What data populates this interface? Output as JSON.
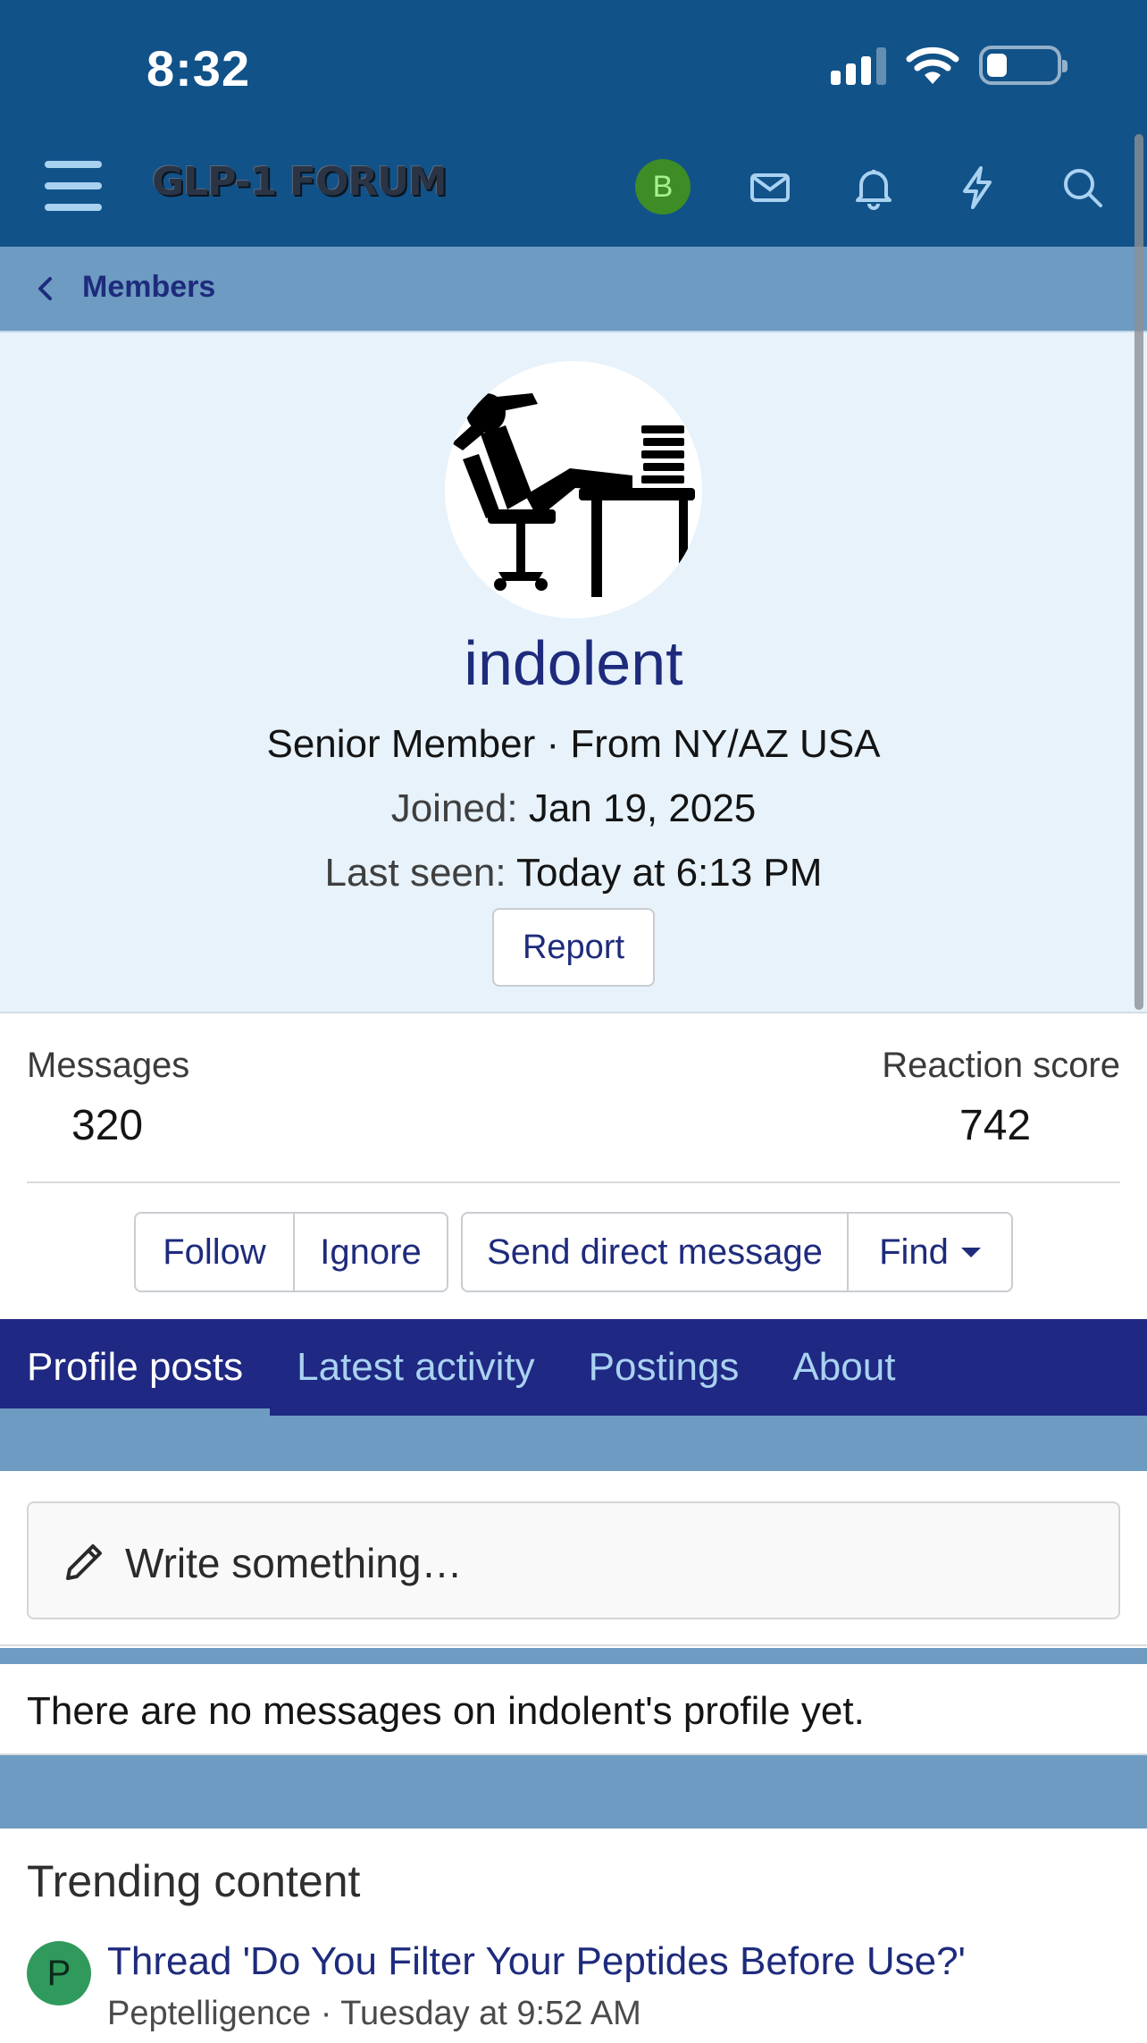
{
  "status_bar": {
    "time": "8:32"
  },
  "header": {
    "logo_text": "GLP-1 FORUM",
    "user_initial": "B",
    "icons": [
      "menu-icon",
      "mail-icon",
      "bell-icon",
      "lightning-icon",
      "search-icon"
    ]
  },
  "breadcrumb": {
    "label": "Members"
  },
  "profile": {
    "username": "indolent",
    "title_line": "Senior Member · From NY/AZ USA",
    "joined_label": "Joined:",
    "joined_value": "Jan 19, 2025",
    "last_seen_label": "Last seen:",
    "last_seen_value": "Today at 6:13 PM",
    "report_label": "Report"
  },
  "stats": {
    "messages_label": "Messages",
    "messages_value": "320",
    "reaction_label": "Reaction score",
    "reaction_value": "742"
  },
  "actions": {
    "follow": "Follow",
    "ignore": "Ignore",
    "send_dm": "Send direct message",
    "find": "Find"
  },
  "tabs": [
    "Profile posts",
    "Latest activity",
    "Postings",
    "About"
  ],
  "composer": {
    "placeholder": "Write something…"
  },
  "empty_message": "There are no messages on indolent's profile yet.",
  "trending": {
    "title": "Trending content",
    "items": [
      {
        "avatar_initial": "P",
        "title": "Thread 'Do You Filter Your Peptides Before Use?'",
        "meta": "Peptelligence · Tuesday at 9:52 AM"
      }
    ]
  },
  "colors": {
    "header_bg": "#115289",
    "subbar_bg": "#6d9bc2",
    "tab_bg": "#1f2882",
    "link": "#1e2b7c",
    "profile_bg": "#e7f2fb"
  }
}
